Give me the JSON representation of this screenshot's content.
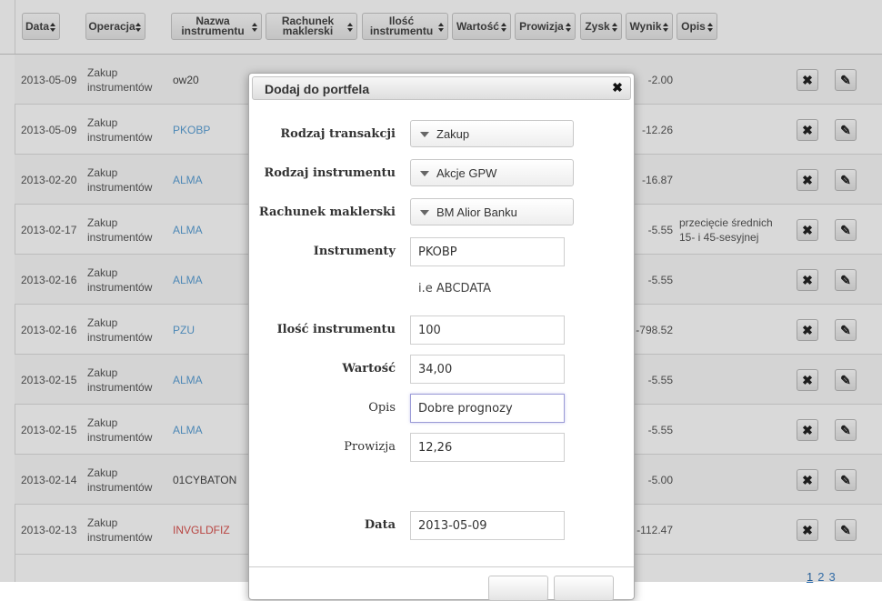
{
  "table": {
    "headers": [
      {
        "id": "data",
        "label": "Data"
      },
      {
        "id": "operacja",
        "label": "Operacja"
      },
      {
        "id": "nazwa",
        "label": "Nazwa instrumentu"
      },
      {
        "id": "rachunek",
        "label": "Rachunek maklerski"
      },
      {
        "id": "ilosc",
        "label": "Ilość instrumentu"
      },
      {
        "id": "wartosc",
        "label": "Wartość"
      },
      {
        "id": "prowizja",
        "label": "Prowizja"
      },
      {
        "id": "zysk",
        "label": "Zysk"
      },
      {
        "id": "wynik",
        "label": "Wynik"
      },
      {
        "id": "opis",
        "label": "Opis"
      }
    ],
    "rows": [
      {
        "date": "2013-05-09",
        "op": "Zakup instrumentów",
        "name": "ow20",
        "style": "plain",
        "wynik": "-2.00",
        "opis": ""
      },
      {
        "date": "2013-05-09",
        "op": "Zakup instrumentów",
        "name": "PKOBP",
        "style": "link",
        "wynik": "-12.26",
        "opis": ""
      },
      {
        "date": "2013-02-20",
        "op": "Zakup instrumentów",
        "name": "ALMA",
        "style": "link",
        "wynik": "-16.87",
        "opis": ""
      },
      {
        "date": "2013-02-17",
        "op": "Zakup instrumentów",
        "name": "ALMA",
        "style": "link",
        "wynik": "-5.55",
        "opis": "przecięcie średnich 15- i 45-sesyjnej"
      },
      {
        "date": "2013-02-16",
        "op": "Zakup instrumentów",
        "name": "ALMA",
        "style": "link",
        "wynik": "-5.55",
        "opis": ""
      },
      {
        "date": "2013-02-16",
        "op": "Zakup instrumentów",
        "name": "PZU",
        "style": "link",
        "wynik": "-798.52",
        "opis": ""
      },
      {
        "date": "2013-02-15",
        "op": "Zakup instrumentów",
        "name": "ALMA",
        "style": "link",
        "wynik": "-5.55",
        "opis": ""
      },
      {
        "date": "2013-02-15",
        "op": "Zakup instrumentów",
        "name": "ALMA",
        "style": "link",
        "wynik": "-5.55",
        "opis": ""
      },
      {
        "date": "2013-02-14",
        "op": "Zakup instrumentów",
        "name": "01CYBATON",
        "style": "plain",
        "wynik": "-5.00",
        "opis": ""
      },
      {
        "date": "2013-02-13",
        "op": "Zakup instrumentów",
        "name": "INVGLDFIZ",
        "style": "red",
        "wynik": "-112.47",
        "opis": ""
      }
    ],
    "delete_glyph": "✖",
    "edit_glyph": "✎"
  },
  "pagination": {
    "pages": [
      "1",
      "2",
      "3"
    ],
    "current": "1"
  },
  "modal": {
    "title": "Dodaj do portfela",
    "close_glyph": "✖",
    "fields": {
      "rodzaj_transakcji": {
        "label": "Rodzaj transakcji",
        "value": "Zakup"
      },
      "rodzaj_instrumentu": {
        "label": "Rodzaj instrumentu",
        "value": "Akcje GPW"
      },
      "rachunek": {
        "label": "Rachunek maklerski",
        "value": "BM Alior Banku"
      },
      "instrumenty": {
        "label": "Instrumenty",
        "value": "PKOBP"
      },
      "hint": "i.e ABCDATA",
      "ilosc": {
        "label": "Ilość instrumentu",
        "value": "100"
      },
      "wartosc": {
        "label": "Wartość",
        "value": "34,00"
      },
      "opis": {
        "label": "Opis",
        "value": "Dobre prognozy"
      },
      "prowizja": {
        "label": "Prowizja",
        "value": "12,26"
      },
      "data": {
        "label": "Data",
        "value": "2013-05-09"
      }
    }
  },
  "colors": {
    "link": "#5ba0d6",
    "red": "#d9534f",
    "accent_focus": "#9b9bd6"
  }
}
